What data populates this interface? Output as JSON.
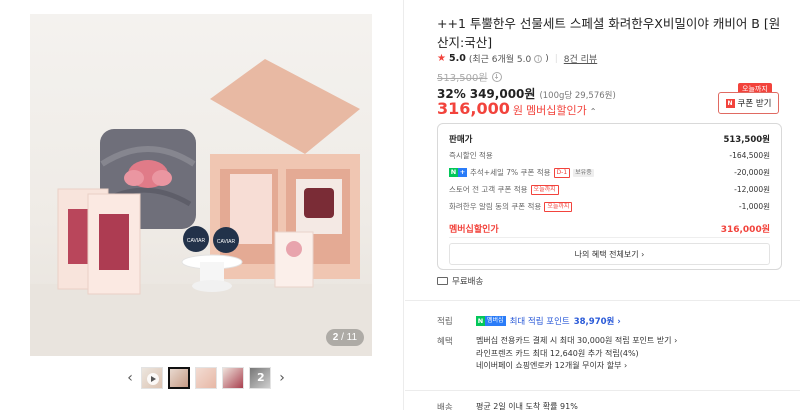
{
  "gallery": {
    "counter_current": "2",
    "counter_total": "/ 11",
    "prev_icon": "chevron-left-icon",
    "next_icon": "chevron-right-icon",
    "main_image": {
      "box_left_text": "CAVIAR",
      "box_right_text": "CAVIAR"
    },
    "thumb_badge": "2"
  },
  "product": {
    "title": "++1 투뿔한우 선물세트 스페셜 화려한우X비밀이야 캐비어 B [원산지:국산]",
    "rating_score": "5.0",
    "rating_note": "(최근 6개월 5.0",
    "rating_note_close": ")",
    "review_count": "8건 리뷰",
    "original_price": "513,500원",
    "discount_rate": "32%",
    "discount_price": "349,000원",
    "unit_price": "(100g당 29,576원)",
    "member_price": "316,000",
    "member_price_won": "원",
    "member_label": "멤버십할인가",
    "today_tag": "오늘까지",
    "coupon_label": "쿠폰 받기",
    "coupon_icon": "N"
  },
  "breakdown": {
    "sale_label": "판매가",
    "sale_value": "513,500원",
    "rows": [
      {
        "label": "즉시할인 적용",
        "value": "-164,500원"
      },
      {
        "label": "추석+세일 7% 쿠폰 적용",
        "tag": "D-1",
        "tag2": "보유중",
        "value": "-20,000원"
      },
      {
        "label": "스토어 전 고객 쿠폰 적용",
        "tag": "오늘까지",
        "value": "-12,000원"
      },
      {
        "label": "화려한우 알림 동의 쿠폰 적용",
        "tag": "오늘까지",
        "value": "-1,000원"
      }
    ],
    "total_label": "멤버십할인가",
    "total_value": "316,000원",
    "all_benefits": "나의 혜택 전체보기 ›"
  },
  "shipping": {
    "free_label": "무료배송"
  },
  "points": {
    "label": "적립",
    "badge_n": "N",
    "badge_m": "멤버십",
    "text": "최대 적립 포인트",
    "value": "38,970원 ›"
  },
  "benefits": {
    "label": "혜택",
    "items": [
      "멤버십 전용카드 결제 시 최대 30,000원 적립 포인트 받기 ›",
      "라인프렌즈 카드 최대 12,640원 추가 적립(4%)",
      "네이버페이 쇼핑엔로카 12개월 무이자 할부 ›"
    ]
  },
  "delivery": {
    "label": "배송",
    "text": "평균 2일 이내 도착 확률 91%"
  },
  "colors": {
    "accent_red": "#f2433c",
    "naver_green": "#03c75a",
    "membership_blue": "#2a7cf8"
  }
}
